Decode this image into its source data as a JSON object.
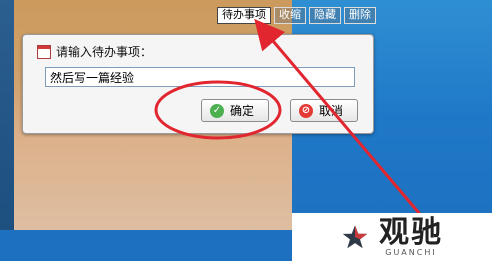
{
  "topbar": {
    "items": [
      {
        "label": "待办事项"
      },
      {
        "label": "收缩"
      },
      {
        "label": "隐藏"
      },
      {
        "label": "删除"
      }
    ]
  },
  "dialog": {
    "title": "请输入待办事项：",
    "input_value": "然后写一篇经验",
    "ok_label": "确定",
    "cancel_label": "取消"
  },
  "watermark": {
    "title": "观驰",
    "subtitle": "GUANCHI"
  },
  "colors": {
    "annotation_red": "#e2262f",
    "desktop_blue": "#1f78c7"
  },
  "icons": {
    "dialog_title": "calendar-icon",
    "ok": "check-icon",
    "cancel": "cancel-icon",
    "watermark": "star-logo-icon"
  }
}
